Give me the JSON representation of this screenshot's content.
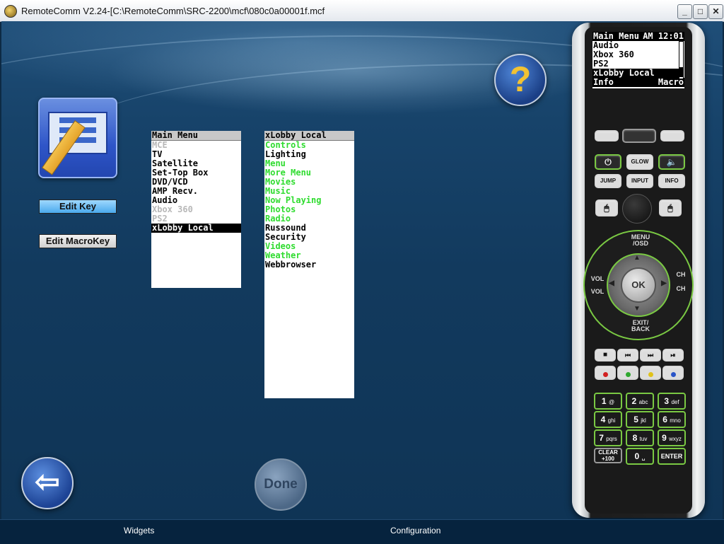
{
  "window": {
    "title": "RemoteComm V2.24-[C:\\RemoteComm\\SRC-2200\\mcf\\080c0a00001f.mcf",
    "controls": [
      "_",
      "□",
      "✕"
    ]
  },
  "left_panel": {
    "edit_key_label": "Edit Key",
    "edit_macrokey_label": "Edit MacroKey"
  },
  "main_menu_list": {
    "header": "Main Menu",
    "items": [
      {
        "label": "MCE",
        "style": "grey"
      },
      {
        "label": "TV",
        "style": "black"
      },
      {
        "label": "Satellite",
        "style": "black"
      },
      {
        "label": "Set-Top Box",
        "style": "black"
      },
      {
        "label": "DVD/VCD",
        "style": "black"
      },
      {
        "label": "AMP Recv.",
        "style": "black"
      },
      {
        "label": "Audio",
        "style": "black"
      },
      {
        "label": "Xbox 360",
        "style": "grey"
      },
      {
        "label": "PS2",
        "style": "grey"
      },
      {
        "label": "xLobby Local",
        "style": "selected"
      }
    ]
  },
  "xlobby_list": {
    "header": "xLobby Local",
    "items": [
      {
        "label": "Controls",
        "style": "green"
      },
      {
        "label": "Lighting",
        "style": "black"
      },
      {
        "label": "Menu",
        "style": "green"
      },
      {
        "label": "More Menu",
        "style": "green"
      },
      {
        "label": "Movies",
        "style": "green"
      },
      {
        "label": "Music",
        "style": "green"
      },
      {
        "label": "Now Playing",
        "style": "green"
      },
      {
        "label": "Photos",
        "style": "green"
      },
      {
        "label": "Radio",
        "style": "green"
      },
      {
        "label": "Russound",
        "style": "black"
      },
      {
        "label": "Security",
        "style": "black"
      },
      {
        "label": "Videos",
        "style": "green"
      },
      {
        "label": "Weather",
        "style": "green"
      },
      {
        "label": "Webbrowser",
        "style": "black"
      }
    ]
  },
  "help_button": {
    "glyph": "?"
  },
  "back_button": {
    "glyph": "⇦"
  },
  "done_button": {
    "label": "Done"
  },
  "remote": {
    "lcd": {
      "title": "Main Menu",
      "time": "AM 12:01",
      "rows": [
        "Audio",
        "Xbox 360",
        "PS2",
        "xLobby Local"
      ],
      "softkey_left": "Info",
      "softkey_right": "Macro"
    },
    "buttons": {
      "glow": "GLOW",
      "jump": "JUMP",
      "input": "INPUT",
      "info": "INFO",
      "menu_osd": "MENU /OSD",
      "ok": "OK",
      "exit_back": "EXIT/ BACK",
      "vol_up": "VOL",
      "vol_down": "VOL",
      "ch_up": "CH",
      "ch_down": "CH",
      "clear": "CLEAR",
      "clear_sub": "+100",
      "enter": "ENTER"
    },
    "keypad": [
      {
        "digit": "1",
        "sub": "@"
      },
      {
        "digit": "2",
        "sub": "abc"
      },
      {
        "digit": "3",
        "sub": "def"
      },
      {
        "digit": "4",
        "sub": "ghi"
      },
      {
        "digit": "5",
        "sub": "jkl"
      },
      {
        "digit": "6",
        "sub": "mno"
      },
      {
        "digit": "7",
        "sub": "pqrs"
      },
      {
        "digit": "8",
        "sub": "tuv"
      },
      {
        "digit": "9",
        "sub": "wxyz"
      },
      {
        "digit": "0",
        "sub": "␣"
      }
    ],
    "color_keys": [
      "#d22020",
      "#2fa82f",
      "#e0c21a",
      "#2a55c8"
    ]
  },
  "taskbar": {
    "widgets_label": "Widgets",
    "configuration_label": "Configuration"
  }
}
